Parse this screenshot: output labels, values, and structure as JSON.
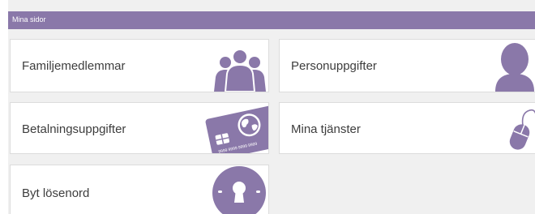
{
  "header": {
    "title": "Mina sidor"
  },
  "tiles": [
    {
      "label": "Familjemedlemmar",
      "icon": "family-icon"
    },
    {
      "label": "Personuppgifter",
      "icon": "person-icon"
    },
    {
      "label": "Betalningsuppgifter",
      "icon": "credit-card-icon",
      "card_number": "9999 9999 9999 9999"
    },
    {
      "label": "Mina tjänster",
      "icon": "mouse-icon"
    },
    {
      "label": "Byt lösenord",
      "icon": "keyhole-icon"
    }
  ],
  "colors": {
    "header_bg": "#8a78a9",
    "icon": "#8a78a9",
    "page_bg": "#f0f0f0",
    "tile_bg": "#ffffff",
    "tile_text": "#3d3d3d"
  }
}
